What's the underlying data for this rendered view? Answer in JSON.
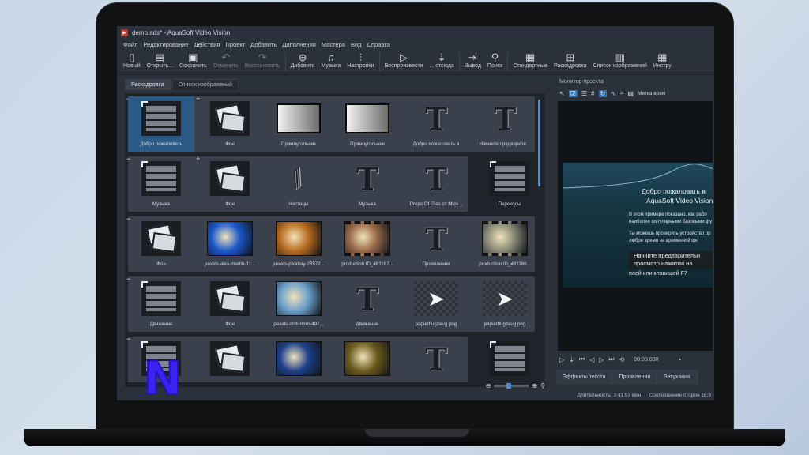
{
  "window": {
    "title": "demo.ads* - AquaSoft Video Vision"
  },
  "menu": [
    "Файл",
    "Редактирование",
    "Действия",
    "Проект",
    "Добавить",
    "Дополнения",
    "Мастера",
    "Вид",
    "Справка"
  ],
  "toolbar": {
    "new": "Новый",
    "open": "Открыть...",
    "save": "Сохранить",
    "undo": "Отменить",
    "redo": "Восстановить",
    "add": "Добавить",
    "music": "Музыка",
    "settings": "Настройки",
    "play": "Воспроизвести",
    "from": "... отсюда",
    "exit": "Вывод",
    "search": "Поиск",
    "standard": "Стандартные",
    "storyboard": "Раскадровка",
    "image_list": "Список изображений",
    "tools": "Инстру"
  },
  "tabs": {
    "storyboard": "Раскадровка",
    "image_list": "Список изображений"
  },
  "rows": [
    {
      "cells": [
        {
          "label": "Добро пожаловать",
          "kind": "brick",
          "selected": true
        },
        {
          "label": "Фон",
          "kind": "photos"
        },
        {
          "label": "Прямоугольник",
          "kind": "gradient"
        },
        {
          "label": "Прямоугольник",
          "kind": "gradient"
        },
        {
          "label": "Добро пожаловать в",
          "kind": "text"
        },
        {
          "label": "Начните предварите...",
          "kind": "text"
        }
      ]
    },
    {
      "cells": [
        {
          "label": "Музыка",
          "kind": "brick"
        },
        {
          "label": "Фон",
          "kind": "photos"
        },
        {
          "label": "Частицы",
          "kind": "particles"
        },
        {
          "label": "Музыка",
          "kind": "text"
        },
        {
          "label": "Drops Of Glas от Musi...",
          "kind": "text"
        },
        {
          "label": "Переходы",
          "kind": "brick"
        }
      ]
    },
    {
      "cells": [
        {
          "label": "Фон",
          "kind": "photos"
        },
        {
          "label": "pexels-alex-martin-11...",
          "kind": "photo",
          "color": "#1a57c9"
        },
        {
          "label": "pexels-pixabay-23572...",
          "kind": "photo",
          "color": "#b86a1e"
        },
        {
          "label": "production ID_481187...",
          "kind": "film",
          "color": "#9a6a4a"
        },
        {
          "label": "Проявления",
          "kind": "text"
        },
        {
          "label": "production ID_481186...",
          "kind": "film",
          "color": "#8a8a78"
        }
      ]
    },
    {
      "cells": [
        {
          "label": "Движение",
          "kind": "brick"
        },
        {
          "label": "Фон",
          "kind": "photos"
        },
        {
          "label": "pexels-cottonbro-497...",
          "kind": "photo",
          "color": "#6b9fc9"
        },
        {
          "label": "Движения",
          "kind": "text"
        },
        {
          "label": "papierflugzeug.png",
          "kind": "plane"
        },
        {
          "label": "papierflugzeug.png",
          "kind": "plane"
        }
      ]
    },
    {
      "cells": [
        {
          "label": "",
          "kind": "brick"
        },
        {
          "label": "",
          "kind": "photos"
        },
        {
          "label": "",
          "kind": "photo",
          "color": "#1d3f8a"
        },
        {
          "label": "",
          "kind": "photo",
          "color": "#6b5a1c"
        },
        {
          "label": "",
          "kind": "text"
        },
        {
          "label": "",
          "kind": "brick"
        }
      ]
    }
  ],
  "preview_panel": {
    "title": "Монитор проекта",
    "time_label": "Метка врем",
    "heading_1": "Добро пожаловать в",
    "heading_2": "AquaSoft Video Vision",
    "p1": "В этом примере показано, как рабо",
    "p2": "наиболее популярными базовыми фу",
    "p3": "Ты можешь проверить устройство пр",
    "p4": "любое время на временной шк",
    "btn1": "Начните предварительн",
    "btn2": "просмотр нажатия на",
    "btn3": "плей или клавишей F7",
    "timecode": "00:00.000",
    "tabs": [
      "Эффекты текста",
      "Проявления",
      "Затухания"
    ]
  },
  "status": {
    "duration": "Длительность: 3:41.93 мин",
    "aspect": "Соотношение сторон 16:9"
  },
  "overlay_logo": "N"
}
